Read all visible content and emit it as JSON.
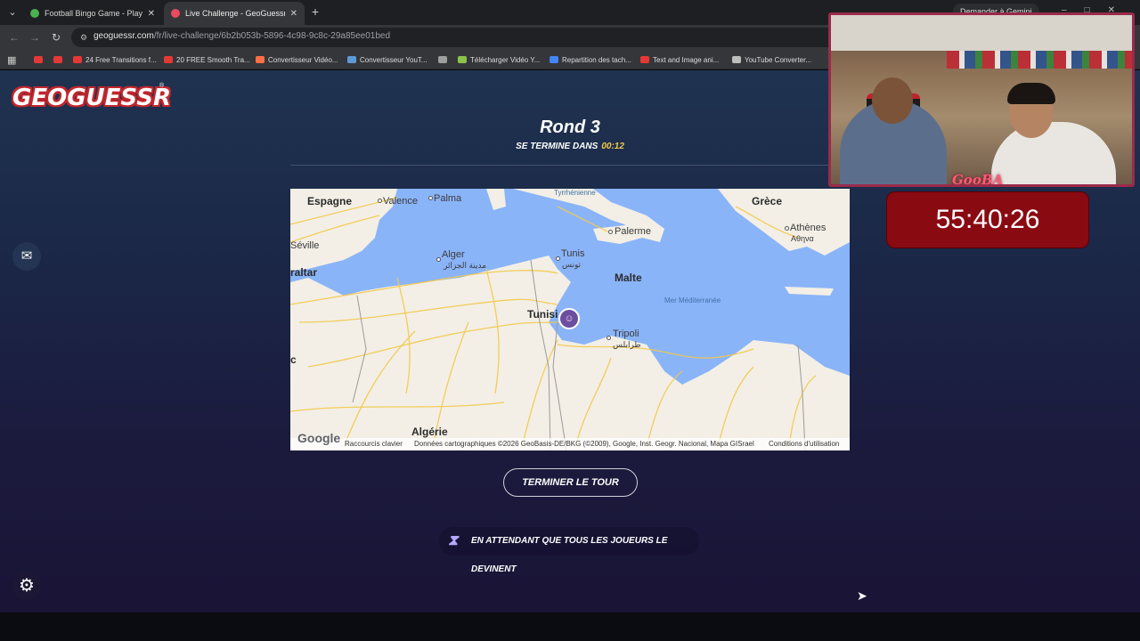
{
  "browser": {
    "tabs": [
      {
        "title": "Football Bingo Game - Play No",
        "active": false,
        "favicon_color": "#4caf50"
      },
      {
        "title": "Live Challenge - GeoGuessr",
        "active": true,
        "favicon_color": "#e84a5f"
      }
    ],
    "new_tab_icon": "plus-icon",
    "gemini_label": "Demander à Gemini",
    "url_host": "geoguessr.com",
    "url_path": "/fr/live-challenge/6b2b053b-5896-4c98-9c8c-29a85ee01bed",
    "bookmarks": [
      {
        "label": "",
        "color": "#e53935"
      },
      {
        "label": "",
        "color": "#e53935"
      },
      {
        "label": "24 Free Transitions f...",
        "color": "#e53935"
      },
      {
        "label": "20 FREE Smooth Tra...",
        "color": "#e53935"
      },
      {
        "label": "Convertisseur Vidéo...",
        "color": "#ff7043"
      },
      {
        "label": "Convertisseur YouT...",
        "color": "#5c9bd6"
      },
      {
        "label": "",
        "color": "#9e9e9e"
      },
      {
        "label": "Télécharger Vidéo Y...",
        "color": "#8bc34a"
      },
      {
        "label": "Repartition des tach...",
        "color": "#4285f4"
      },
      {
        "label": "Text and Image ani...",
        "color": "#e53935"
      },
      {
        "label": "YouTube Converter...",
        "color": "#bdbdbd"
      }
    ]
  },
  "game": {
    "logo": "GEOGUESSR",
    "logo_reg": "®",
    "round_title": "Rond 3",
    "ends_in_label": "SE TERMINE DANS",
    "timer": "00:12",
    "finish_button": "TERMINER LE TOUR",
    "waiting_text": "EN ATTENDANT QUE TOUS LES JOUEURS LE DEVINENT"
  },
  "map": {
    "labels": {
      "espagne": "Espagne",
      "valence": "Valence",
      "palma": "Palma",
      "tyrrhenienne": "Tyrrhénienne",
      "grece": "Grèce",
      "seville": "Séville",
      "alger": "Alger",
      "alger_ar": "مدينة الجزائر",
      "tunis": "Tunis",
      "tunis_ar": "تونس",
      "palerme": "Palerme",
      "athenes": "Athènes",
      "athenes_gr": "Αθηνα",
      "gibraltar": "raltar",
      "malte": "Malte",
      "mer": "Mer Méditerranée",
      "tunisie": "Tunisi",
      "tripoli": "Tripoli",
      "tripoli_ar": "طرابلس",
      "c": "c",
      "algerie": "Algérie"
    },
    "footer": {
      "google": "Google",
      "shortcuts": "Raccourcis clavier",
      "data": "Données cartographiques ©2026 GeoBasis-DE/BKG (©2009), Google, Inst. Geogr. Nacional, Mapa GISrael",
      "terms": "Conditions d'utilisation"
    },
    "colors": {
      "sea": "#8ab4f8",
      "land": "#f3efe6",
      "roads": "#f2c94c"
    }
  },
  "overlay": {
    "brand": "GooBA",
    "counter": "55:40:26"
  }
}
